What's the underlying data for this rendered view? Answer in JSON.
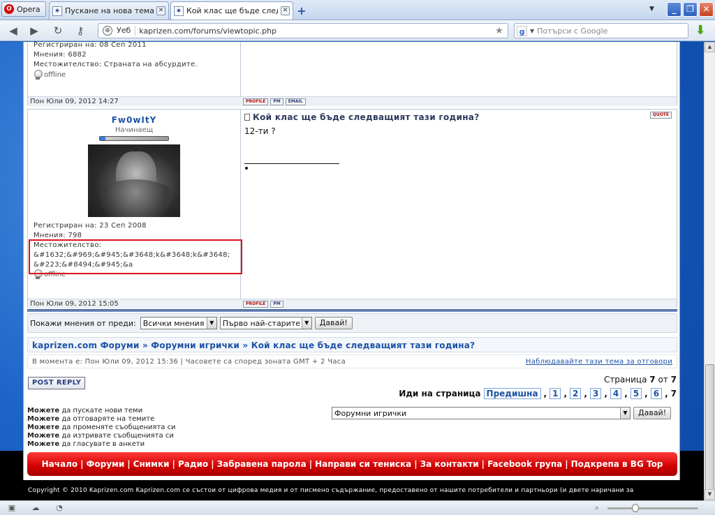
{
  "browser": {
    "opera_label": "Opera",
    "tabs": [
      {
        "title": "Пускане на нова тема - ..."
      },
      {
        "title": "Кой клас ще бъде след..."
      }
    ],
    "address": {
      "scheme_label": "Уеб",
      "url": "kaprizen.com/forums/viewtopic.php"
    },
    "search_placeholder": "Потърси с Google"
  },
  "post_prev": {
    "registered": "Регистриран на: 08 Сеп 2011",
    "posts": "Мнения: 6882",
    "location": "Местожителство: Страната на абсурдите.",
    "status": "offline",
    "date": "Пон Юли 09, 2012 14:27",
    "buttons": [
      "PROFILE",
      "PM",
      "EMAIL"
    ]
  },
  "post": {
    "username": "Fw0wItY",
    "rank": "Начинаещ",
    "rank_progress": 0.08,
    "title": "Кой клас ще бъде следващият тази година?",
    "quote_label": "QUOTE",
    "body": "12-ти ?",
    "registered": "Регистриран на: 23 Сеп 2008",
    "posts": "Мнения: 798",
    "location_label": "Местожителство:",
    "location_value_1": "&#1632;&#969;&#945;&#3648;k&#3648;k&#3648;",
    "location_value_2": "&#223;&#8494;&#945;&a",
    "status": "offline",
    "date": "Пон Юли 09, 2012 15:05",
    "buttons": [
      "PROFILE",
      "PM"
    ]
  },
  "sort": {
    "label": "Покажи мнения от преди:",
    "period": "Всички мнения",
    "order": "Първо най-старите",
    "go": "Давай!"
  },
  "breadcrumb": {
    "site": "kaprizen.com Форуми",
    "sep": "»",
    "forum": "Форумни игрички",
    "topic": "Кой клас ще бъде следващият тази година?"
  },
  "time": {
    "now": "В момента е: Пон Юли 09, 2012 15:36 | Часовете са според зоната GMT + 2 Часа",
    "watch": "Наблюдавайте тази тема за отговори"
  },
  "post_reply": "POST REPLY",
  "pagination": {
    "page_label": "Страница",
    "current": "7",
    "of": "от",
    "total": "7",
    "goto_label": "Иди на страница",
    "prev": "Предишна",
    "pages": [
      "1",
      "2",
      "3",
      "4",
      "5",
      "6"
    ],
    "last": "7"
  },
  "permissions": [
    {
      "bold": "Можете",
      "text": "да пускате нови теми"
    },
    {
      "bold": "Можете",
      "text": "да отговаряте на темите"
    },
    {
      "bold": "Можете",
      "text": "да променяте съобщенията си"
    },
    {
      "bold": "Можете",
      "text": "да изтривате съобщенията си"
    },
    {
      "bold": "Можете",
      "text": "да гласувате в анкети"
    }
  ],
  "jump": {
    "forum": "Форумни игрички",
    "go": "Давай!"
  },
  "footer_nav": [
    "Начало",
    "Форуми",
    "Снимки",
    "Радио",
    "Забравена парола",
    "Направи си тениска",
    "За контакти",
    "Facebook група",
    "Подкрепа в BG Top"
  ],
  "copyright": "Copyright © 2010 Kaprizen.com      Kaprizen.com се състои от цифрова медия и от писмено съдържание, предоставено от нашите потребители и партньори (и двете наричани за"
}
